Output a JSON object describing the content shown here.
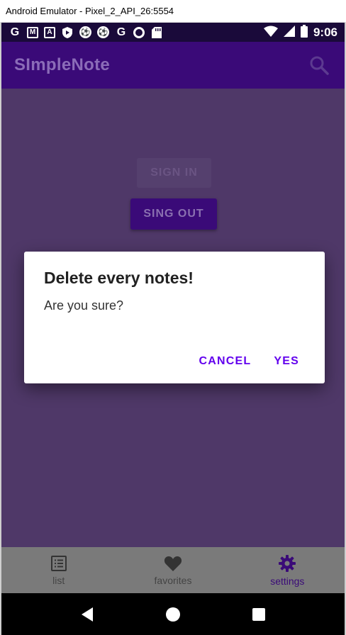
{
  "window": {
    "title": "Android Emulator - Pixel_2_API_26:5554"
  },
  "status_bar": {
    "time": "9:06",
    "icons": [
      "g-icon",
      "gmail-icon",
      "a-icon",
      "shield-icon",
      "soccer-icon",
      "soccer-icon",
      "g-icon",
      "circle-icon",
      "sd-card-icon"
    ]
  },
  "app_bar": {
    "title": "SImpleNote"
  },
  "content": {
    "sign_in_label": "SIGN IN",
    "sign_out_label": "SING OUT"
  },
  "dialog": {
    "title": "Delete every notes!",
    "message": "Are you sure?",
    "cancel_label": "CANCEL",
    "yes_label": "YES"
  },
  "bottom_nav": {
    "items": [
      {
        "label": "list",
        "icon": "list-icon"
      },
      {
        "label": "favorites",
        "icon": "heart-icon"
      },
      {
        "label": "settings",
        "icon": "gear-icon"
      }
    ],
    "active": "settings"
  },
  "colors": {
    "app_bar": "#3a0a78",
    "status_bar": "#1a0a3a",
    "accent": "#6200ee",
    "overlay_bg": "#4f3868"
  }
}
